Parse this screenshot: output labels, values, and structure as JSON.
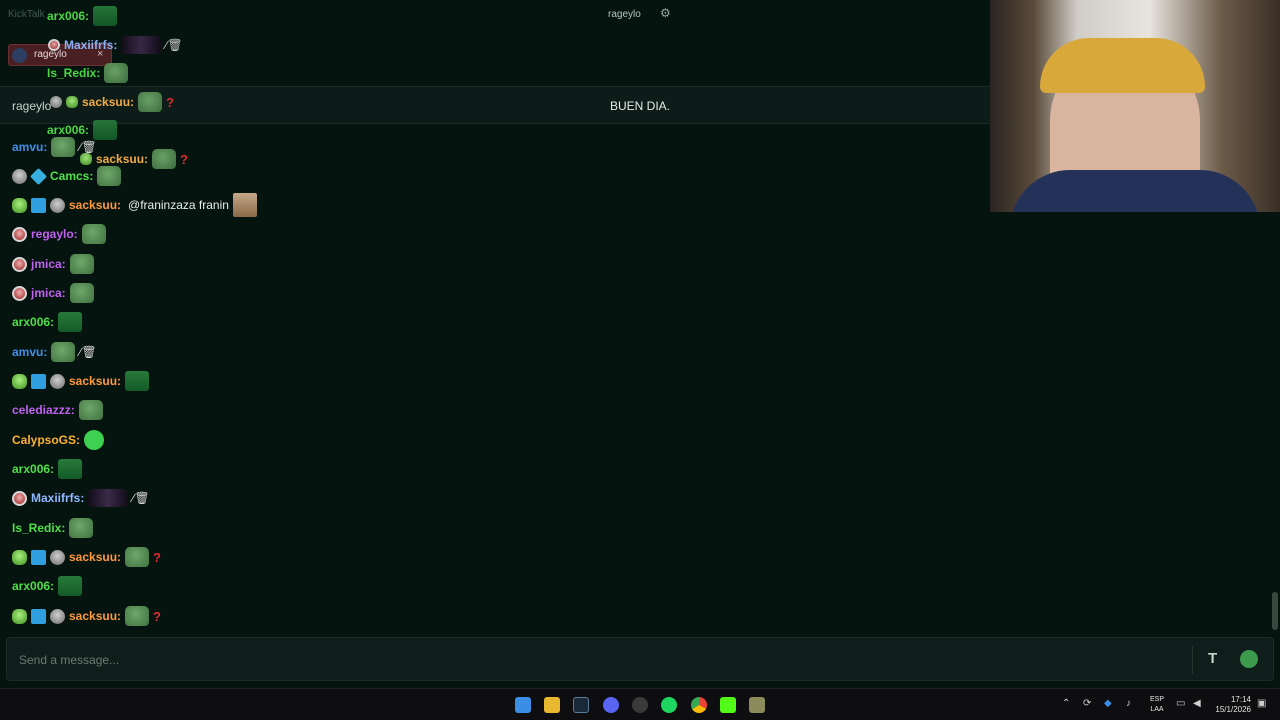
{
  "header": {
    "brand": "KickTalk",
    "channel_center": "rageylo",
    "gear_icon": "gear-icon",
    "active_tab": {
      "label": "rageylo",
      "close": "×"
    }
  },
  "pinned": {
    "user": "rageylo",
    "text": "BUEN DIA."
  },
  "ghost_messages": [
    {
      "user": "arx006:",
      "color": "#4fe047"
    },
    {
      "user": "Maxiifrfs:",
      "color": "#8fb8ff"
    },
    {
      "user": "Is_Redix:",
      "color": "#4fe047"
    },
    {
      "user": "sacksuu:",
      "color": "#ffb347"
    },
    {
      "user": "arx006:",
      "color": "#4fe047"
    },
    {
      "user": "sacksuu:",
      "color": "#ffb347"
    }
  ],
  "messages": [
    {
      "user": "amvu:",
      "color": "#3f8fe8",
      "text": ""
    },
    {
      "user": "Camcs:",
      "color": "#4fe047",
      "text": ""
    },
    {
      "user": "sacksuu:",
      "color": "#ff9a3c",
      "text": "@franinzaza franin"
    },
    {
      "user": "regaylo:",
      "color": "#c060f0",
      "text": ""
    },
    {
      "user": "jmica:",
      "color": "#c060f0",
      "text": ""
    },
    {
      "user": "jmica:",
      "color": "#c060f0",
      "text": ""
    },
    {
      "user": "arx006:",
      "color": "#4fe047",
      "text": ""
    },
    {
      "user": "amvu:",
      "color": "#3f8fe8",
      "text": ""
    },
    {
      "user": "sacksuu:",
      "color": "#ff9a3c",
      "text": ""
    },
    {
      "user": "celediazzz:",
      "color": "#c060f0",
      "text": ""
    },
    {
      "user": "CalypsoGS:",
      "color": "#ffb030",
      "text": ""
    },
    {
      "user": "arx006:",
      "color": "#4fe047",
      "text": ""
    },
    {
      "user": "Maxiifrfs:",
      "color": "#8fb8ff",
      "text": ""
    },
    {
      "user": "Is_Redix:",
      "color": "#4fe047",
      "text": ""
    },
    {
      "user": "sacksuu:",
      "color": "#ff9a3c",
      "text": ""
    },
    {
      "user": "arx006:",
      "color": "#4fe047",
      "text": ""
    },
    {
      "user": "sacksuu:",
      "color": "#ff9a3c",
      "text": ""
    }
  ],
  "input": {
    "placeholder": "Send a message..."
  },
  "taskbar": {
    "lang_top": "ESP",
    "lang_bottom": "LAA",
    "time": "17:14",
    "date": "15/1/2026"
  }
}
